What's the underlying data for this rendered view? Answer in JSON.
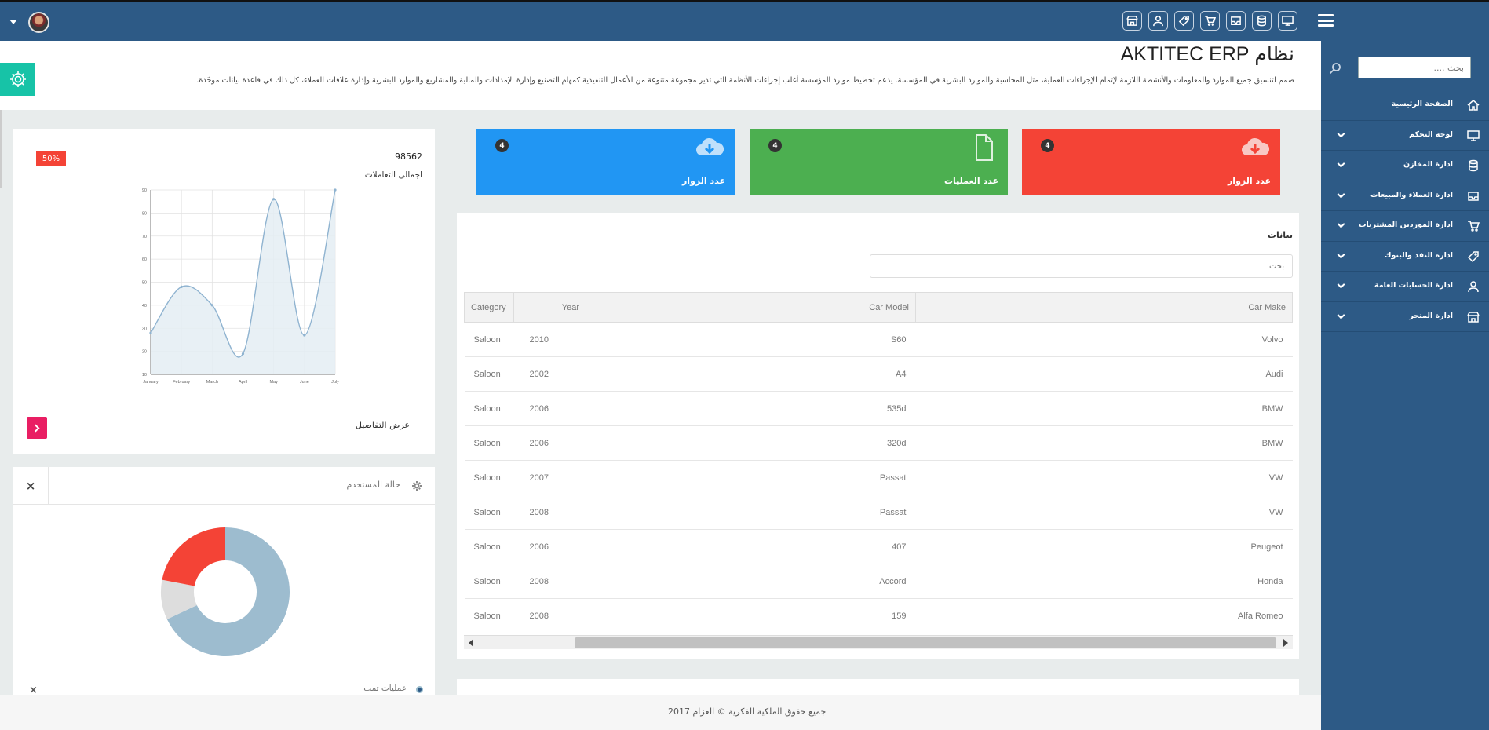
{
  "topbar": {
    "icons": [
      "store-icon",
      "user-icon",
      "tag-icon",
      "cart-icon",
      "inbox-icon",
      "database-icon",
      "monitor-icon"
    ]
  },
  "sidebar": {
    "search_placeholder": "بحث ....",
    "items": [
      {
        "label": "الصفحة الرئيسية",
        "icon": "home-icon",
        "has_submenu": false
      },
      {
        "label": "لوحة التحكم",
        "icon": "monitor-icon",
        "has_submenu": true
      },
      {
        "label": "ادارة المخازن",
        "icon": "database-icon",
        "has_submenu": true
      },
      {
        "label": "ادارة العملاء والمبيعات",
        "icon": "inbox-icon",
        "has_submenu": true
      },
      {
        "label": "ادارة الموردين المشتريات",
        "icon": "cart-icon",
        "has_submenu": true
      },
      {
        "label": "ادارة النقد والبنوك",
        "icon": "tag-icon",
        "has_submenu": true
      },
      {
        "label": "ادارة الحسابات العامة",
        "icon": "user-icon",
        "has_submenu": true
      },
      {
        "label": "ادارة المتجر",
        "icon": "store-icon",
        "has_submenu": true
      }
    ]
  },
  "header": {
    "title": "نظام AKTITEC ERP",
    "description": "صمم لتنسيق جميع الموارد والمعلومات والأنشطة اللازمة لإتمام الإجراءات العملية، مثل المحاسبة والموارد البشرية في المؤسسة. يدعم تخطيط موارد المؤسسة أغلب إجراءات الأنظمة التي تدير مجموعة متنوعة من الأعمال التنفيذية كمهام التصنيع وإدارة الإمدادات والمالية والمشاريع والموارد البشرية وإدارة علاقات العملاء، كل ذلك في قاعدة بيانات موحّدة."
  },
  "cards": [
    {
      "label": "عدد الزوار",
      "badge": "4",
      "icon": "cloud-download-icon",
      "color": "#f44336"
    },
    {
      "label": "عدد العمليات",
      "badge": "4",
      "icon": "document-icon",
      "color": "#4caf50"
    },
    {
      "label": "عدد الزوار",
      "badge": "4",
      "icon": "cloud-download-icon",
      "color": "#2196f3"
    }
  ],
  "data_table": {
    "title": "بيانات",
    "search_placeholder": "بحث",
    "columns": {
      "category": "Category",
      "year": "Year",
      "model": "Car Model",
      "make": "Car Make"
    },
    "rows": [
      {
        "category": "Saloon",
        "year": "2010",
        "model": "S60",
        "make": "Volvo"
      },
      {
        "category": "Saloon",
        "year": "2002",
        "model": "A4",
        "make": "Audi"
      },
      {
        "category": "Saloon",
        "year": "2006",
        "model": "535d",
        "make": "BMW"
      },
      {
        "category": "Saloon",
        "year": "2006",
        "model": "320d",
        "make": "BMW"
      },
      {
        "category": "Saloon",
        "year": "2007",
        "model": "Passat",
        "make": "VW"
      },
      {
        "category": "Saloon",
        "year": "2008",
        "model": "Passat",
        "make": "VW"
      },
      {
        "category": "Saloon",
        "year": "2006",
        "model": "407",
        "make": "Peugeot"
      },
      {
        "category": "Saloon",
        "year": "2008",
        "model": "Accord",
        "make": "Honda"
      },
      {
        "category": "Saloon",
        "year": "2008",
        "model": "159",
        "make": "Alfa Romeo"
      }
    ]
  },
  "transactions": {
    "value": "98562",
    "label": "اجمالى التعاملات",
    "percent": "50%",
    "details_label": "عرض التفاصيل"
  },
  "chart_data": {
    "type": "area",
    "categories": [
      "January",
      "February",
      "March",
      "April",
      "May",
      "June",
      "July"
    ],
    "values": [
      28,
      48,
      40,
      19,
      86,
      27,
      90
    ],
    "ylim": [
      10,
      90
    ],
    "yticks": [
      10,
      20,
      30,
      40,
      50,
      60,
      70,
      80,
      90
    ],
    "grid": true,
    "line_color": "#8fb3d0",
    "fill_color": "#e4edf3"
  },
  "user_status": {
    "title": "حالة المستخدم",
    "close_label": "×",
    "sub_title": "عمليات تمت",
    "sub_close_label": "×",
    "donut": [
      {
        "value": 68,
        "color": "#9dbccf"
      },
      {
        "value": 10,
        "color": "#dddddd"
      },
      {
        "value": 22,
        "color": "#f44336"
      }
    ]
  },
  "footer": {
    "text": "جميع حقوق الملكية الفكرية © العزام 2017"
  }
}
